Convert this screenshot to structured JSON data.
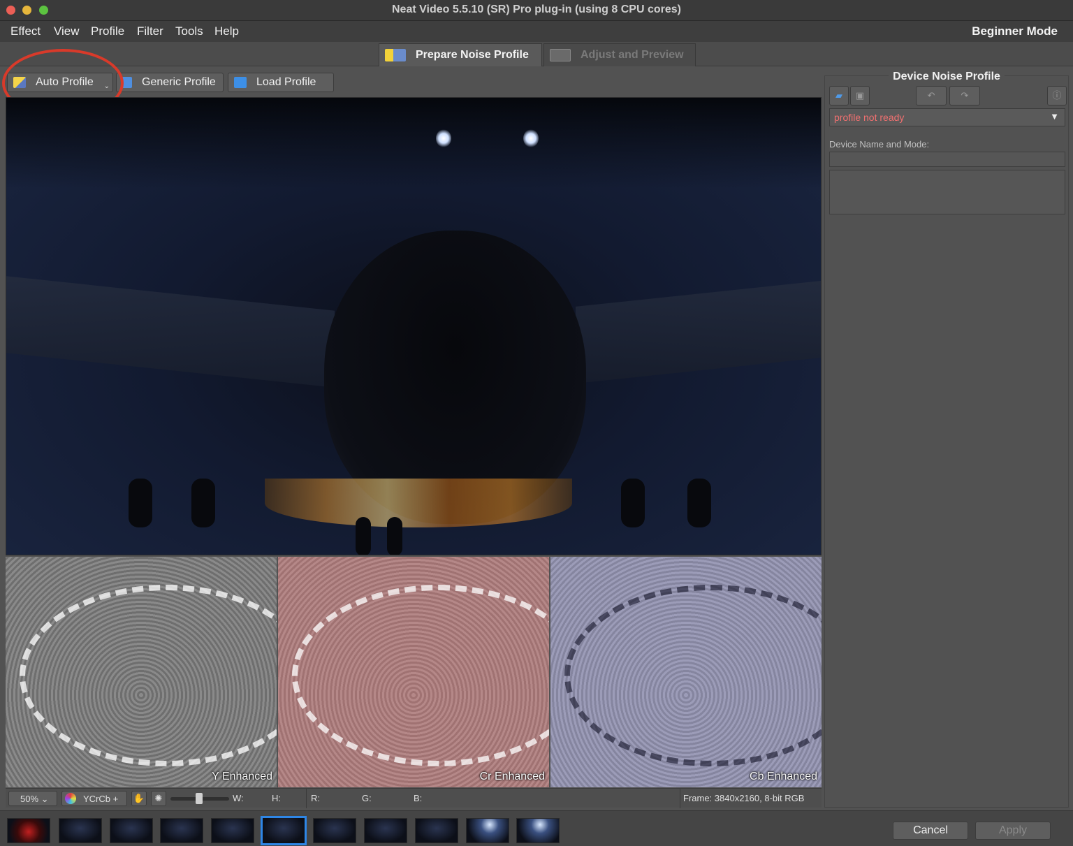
{
  "window": {
    "title": "Neat Video 5.5.10 (SR) Pro plug-in (using 8 CPU cores)"
  },
  "menubar": {
    "items": [
      "Effect",
      "View",
      "Profile",
      "Filter",
      "Tools",
      "Help"
    ],
    "mode": "Beginner Mode"
  },
  "tabs": [
    {
      "label": "Prepare Noise Profile",
      "active": true
    },
    {
      "label": "Adjust and Preview",
      "active": false
    }
  ],
  "toolbar": {
    "auto_profile": "Auto Profile",
    "generic_profile": "Generic Profile",
    "load_profile": "Load Profile"
  },
  "panels": {
    "y": "Y Enhanced",
    "cr": "Cr Enhanced",
    "cb": "Cb Enhanced"
  },
  "statusbar": {
    "zoom": "50%",
    "color_mode": "YCrCb +",
    "w_label": "W:",
    "h_label": "H:",
    "r_label": "R:",
    "g_label": "G:",
    "b_label": "B:",
    "frame_info": "Frame: 3840x2160, 8-bit RGB"
  },
  "device_profile": {
    "title": "Device Noise Profile",
    "status": "profile not ready",
    "device_name_label": "Device Name and Mode:",
    "device_name_value": ""
  },
  "buttons": {
    "cancel": "Cancel",
    "apply": "Apply"
  },
  "colors": {
    "annotation_ring": "#d93a2a",
    "status_error": "#f07070",
    "selected_frame": "#2e86e6"
  },
  "icons": {
    "auto_profile": "auto-profile-icon",
    "generic_profile": "generic-profile-icon",
    "load_profile": "folder-icon",
    "open": "folder-open-icon",
    "save": "floppy-icon",
    "undo": "undo-icon",
    "redo": "redo-icon",
    "info": "info-icon",
    "hand": "hand-icon",
    "brightness": "sun-icon"
  },
  "filmstrip": {
    "frame_count": 11,
    "selected_index": 5
  }
}
